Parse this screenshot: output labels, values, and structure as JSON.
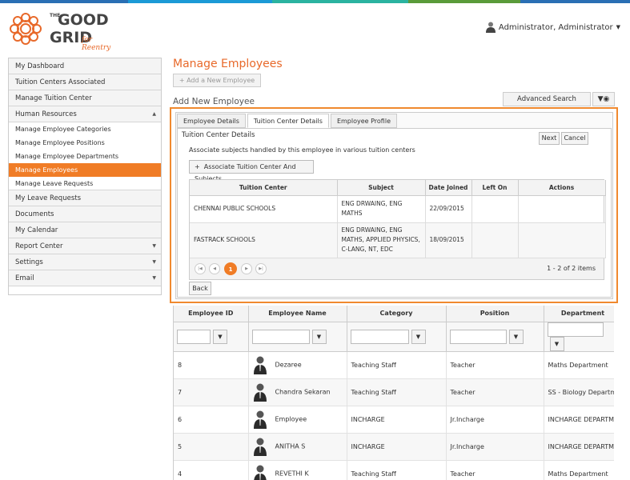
{
  "colors": {
    "accent": "#f07c26",
    "title": "#e8692a",
    "top_stripes": [
      "#2a6fb4",
      "#1b9ad6",
      "#2bb3a0",
      "#5a9b3a",
      "#2a6fb4"
    ]
  },
  "logo": {
    "the": "THE",
    "good": "GOOD",
    "grid": "GRID",
    "for": "for Reentry"
  },
  "header": {
    "user_name": "Administrator, Administrator"
  },
  "sidebar": {
    "items": [
      {
        "label": "My Dashboard"
      },
      {
        "label": "Tuition Centers Associated"
      },
      {
        "label": "Manage Tuition Center"
      },
      {
        "label": "Human Resources",
        "arrow": "▲"
      }
    ],
    "hr_sub": [
      {
        "label": "Manage Employee Categories"
      },
      {
        "label": "Manage Employee Positions"
      },
      {
        "label": "Manage Employee Departments"
      },
      {
        "label": "Manage Employees",
        "active": true
      },
      {
        "label": "Manage Leave Requests"
      }
    ],
    "items2": [
      {
        "label": "My Leave Requests"
      },
      {
        "label": "Documents"
      },
      {
        "label": "My Calendar"
      },
      {
        "label": "Report Center",
        "arrow": "▼"
      },
      {
        "label": "Settings",
        "arrow": "▼"
      },
      {
        "label": "Email",
        "arrow": "▼"
      }
    ]
  },
  "main": {
    "title": "Manage Employees",
    "add_button": "Add a New Employee",
    "add_title": "Add New Employee",
    "advanced_search": "Advanced Search",
    "tabs": [
      "Employee Details",
      "Tuition Center Details",
      "Employee Profile"
    ],
    "panel": {
      "title": "Tuition Center Details",
      "next": "Next",
      "cancel": "Cancel",
      "description": "Associate subjects handled by this employee in various tuition centers",
      "associate_button": "Associate Tuition Center And Subjects",
      "columns": [
        "Tuition Center",
        "Subject",
        "Date Joined",
        "Left On",
        "Actions"
      ],
      "rows": [
        {
          "center": "CHENNAI PUBLIC SCHOOLS",
          "subject_lines": [
            "ENG DRWAING, ENG",
            "MATHS"
          ],
          "joined": "22/09/2015",
          "left": "",
          "actions": ""
        },
        {
          "center": "FASTRACK SCHOOLS",
          "subject_lines": [
            "ENG DRWAING, ENG",
            "MATHS, APPLIED PHYSICS,",
            "C-LANG, NT, EDC"
          ],
          "joined": "18/09/2015",
          "left": "",
          "actions": ""
        }
      ],
      "pager": {
        "current": "1",
        "info": "1 - 2 of 2 items"
      },
      "back": "Back"
    },
    "employees": {
      "columns": [
        "Employee ID",
        "Employee Name",
        "Category",
        "Position",
        "Department"
      ],
      "rows": [
        {
          "id": "8",
          "name": "Dezaree",
          "category": "Teaching Staff",
          "position": "Teacher",
          "department": "Maths Department"
        },
        {
          "id": "7",
          "name": "Chandra Sekaran",
          "category": "Teaching Staff",
          "position": "Teacher",
          "department": "SS - Biology Department"
        },
        {
          "id": "6",
          "name": "Employee",
          "category": "INCHARGE",
          "position": "Jr.Incharge",
          "department": "INCHARGE DEPARTMENT"
        },
        {
          "id": "5",
          "name": "ANITHA S",
          "category": "INCHARGE",
          "position": "Jr.Incharge",
          "department": "INCHARGE DEPARTMENT"
        },
        {
          "id": "4",
          "name": "REVETHI K",
          "category": "Teaching Staff",
          "position": "Teacher",
          "department": "Maths Department"
        }
      ]
    }
  }
}
